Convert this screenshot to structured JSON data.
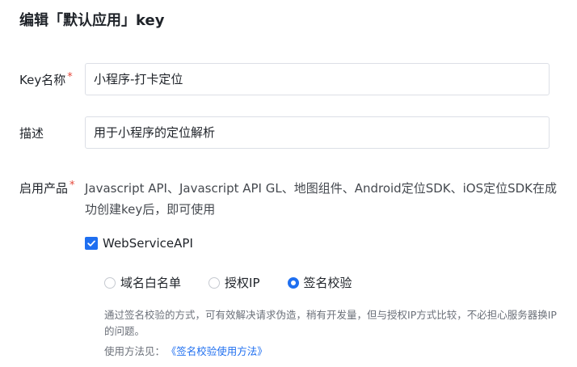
{
  "dialog": {
    "title": "编辑「默认应用」key"
  },
  "form": {
    "key_name": {
      "label": "Key名称",
      "required_mark": "*",
      "value": "小程序-打卡定位"
    },
    "description": {
      "label": "描述",
      "value": "用于小程序的定位解析"
    },
    "products": {
      "label": "启用产品",
      "required_mark": "*",
      "text": "Javascript API、Javascript API GL、地图组件、Android定位SDK、iOS定位SDK在成功创建key后，即可使用"
    },
    "webservice": {
      "checked": true,
      "label": "WebServiceAPI",
      "options": [
        {
          "label": "域名白名单",
          "selected": false
        },
        {
          "label": "授权IP",
          "selected": false
        },
        {
          "label": "签名校验",
          "selected": true
        }
      ],
      "hint": "通过签名校验的方式，可有效解决请求伪造，稍有开发量，但与授权IP方式比较，不必担心服务器换IP的问题。",
      "usage_prefix": "使用方法见：",
      "usage_link": "《签名校验使用方法》"
    }
  },
  "colors": {
    "accent": "#1f6ff0",
    "required": "#e5473a"
  }
}
